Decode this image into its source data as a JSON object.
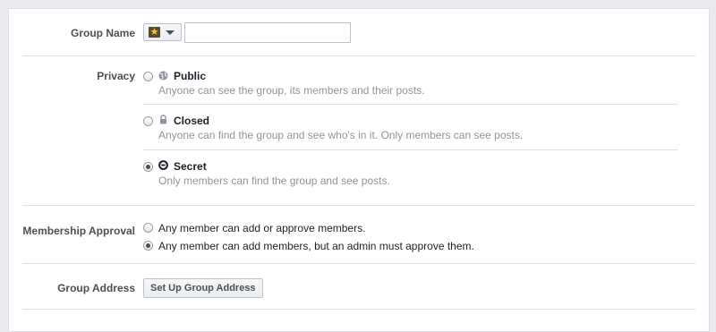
{
  "group_name": {
    "label": "Group Name",
    "icon_picker_icon": "star-icon",
    "input_value": ""
  },
  "privacy": {
    "label": "Privacy",
    "options": [
      {
        "title": "Public",
        "icon": "globe-icon",
        "description": "Anyone can see the group, its members and their posts.",
        "selected": false
      },
      {
        "title": "Closed",
        "icon": "lock-icon",
        "description": "Anyone can find the group and see who's in it. Only members can see posts.",
        "selected": false
      },
      {
        "title": "Secret",
        "icon": "secret-circle-icon",
        "description": "Only members can find the group and see posts.",
        "selected": true
      }
    ]
  },
  "membership_approval": {
    "label": "Membership Approval",
    "options": [
      {
        "text": "Any member can add or approve members.",
        "selected": false
      },
      {
        "text": "Any member can add members, but an admin must approve them.",
        "selected": true
      }
    ]
  },
  "group_address": {
    "label": "Group Address",
    "button_label": "Set Up Group Address"
  },
  "colors": {
    "background": "#e9ebee",
    "panel": "#ffffff",
    "label": "#4b4f56",
    "description": "#90949c",
    "separator": "#dddfe2"
  }
}
